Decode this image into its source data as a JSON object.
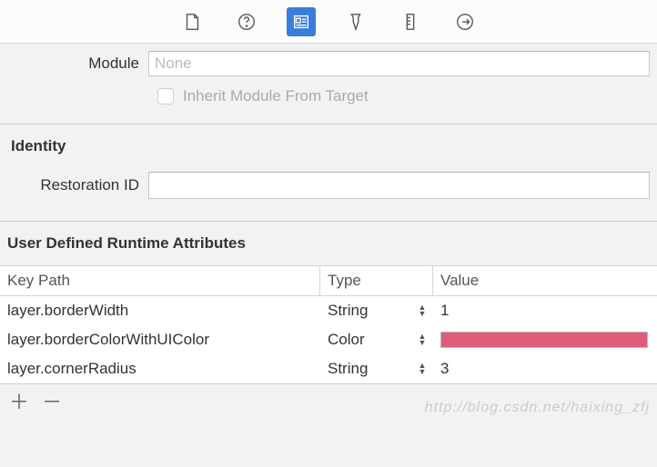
{
  "module": {
    "label": "Module",
    "value": "None",
    "inherit_label": "Inherit Module From Target"
  },
  "identity": {
    "title": "Identity",
    "restoration_label": "Restoration ID",
    "restoration_value": ""
  },
  "attrs": {
    "title": "User Defined Runtime Attributes",
    "headers": {
      "keypath": "Key Path",
      "type": "Type",
      "value": "Value"
    },
    "rows": [
      {
        "keypath": "layer.borderWidth",
        "type": "String",
        "value": "1",
        "is_color": false
      },
      {
        "keypath": "layer.borderColorWithUIColor",
        "type": "Color",
        "value": "#de5c7a",
        "is_color": true
      },
      {
        "keypath": "layer.cornerRadius",
        "type": "String",
        "value": "3",
        "is_color": false
      }
    ]
  },
  "watermark": "http://blog.csdn.net/haixing_zfj"
}
